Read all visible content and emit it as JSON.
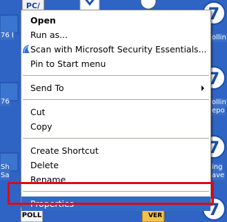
{
  "desktop": {
    "left_labels": [
      "76 I",
      "76",
      "Sh",
      "Sa"
    ],
    "right_labels": [
      "ollin",
      "ollin",
      "epo",
      "ing",
      "ave"
    ],
    "top_icon_text": "PC/",
    "bottom_icons": [
      "POLL",
      "VER"
    ]
  },
  "context_menu": {
    "items": [
      {
        "label": "Open",
        "bold": true
      },
      {
        "label": "Run as..."
      },
      {
        "label": "Scan with Microsoft Security Essentials...",
        "icon": "security-essentials-icon"
      },
      {
        "label": "Pin to Start menu"
      },
      {
        "separator": true
      },
      {
        "label": "Send To",
        "submenu": true
      },
      {
        "separator": true
      },
      {
        "label": "Cut"
      },
      {
        "label": "Copy"
      },
      {
        "separator": true
      },
      {
        "label": "Create Shortcut"
      },
      {
        "label": "Delete"
      },
      {
        "label": "Rename"
      },
      {
        "separator": true
      },
      {
        "label": "Properties",
        "selected": true
      }
    ]
  },
  "colors": {
    "selection": "#316ac5",
    "highlight_box": "#e30613",
    "desktop": "#2f63c4"
  }
}
